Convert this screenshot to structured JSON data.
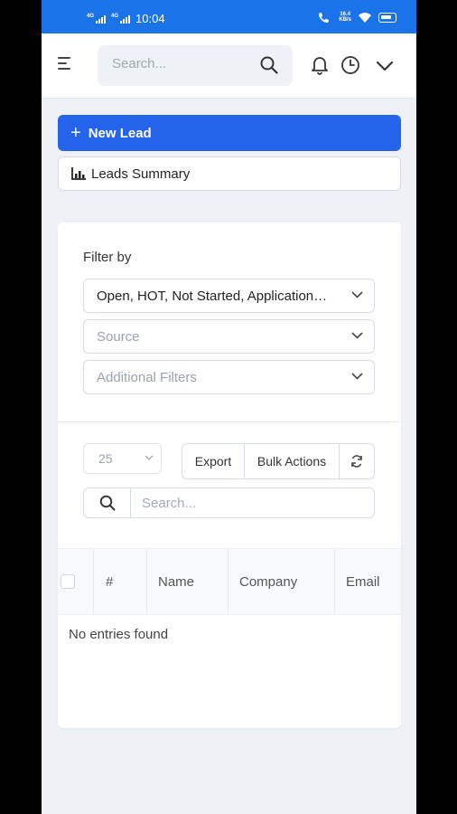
{
  "status_bar": {
    "time": "10:04",
    "network_tag_1": "4G",
    "network_tag_2": "4G",
    "speed_value": "16.4",
    "speed_unit": "KB/s"
  },
  "header": {
    "search_placeholder": "Search..."
  },
  "actions": {
    "new_lead_label": "New Lead",
    "leads_summary_label": "Leads Summary"
  },
  "filters": {
    "label": "Filter by",
    "status_value": "Open, HOT, Not Started, Application…",
    "source_placeholder": "Source",
    "additional_placeholder": "Additional Filters"
  },
  "table_controls": {
    "per_page": "25",
    "export_label": "Export",
    "bulk_actions_label": "Bulk Actions",
    "search_placeholder": "Search..."
  },
  "table": {
    "columns": [
      "#",
      "Name",
      "Company",
      "Email"
    ],
    "empty_message": "No entries found"
  },
  "colors": {
    "status_bar": "#1a73e8",
    "primary_button": "#2563eb",
    "background": "#eef2f7"
  }
}
